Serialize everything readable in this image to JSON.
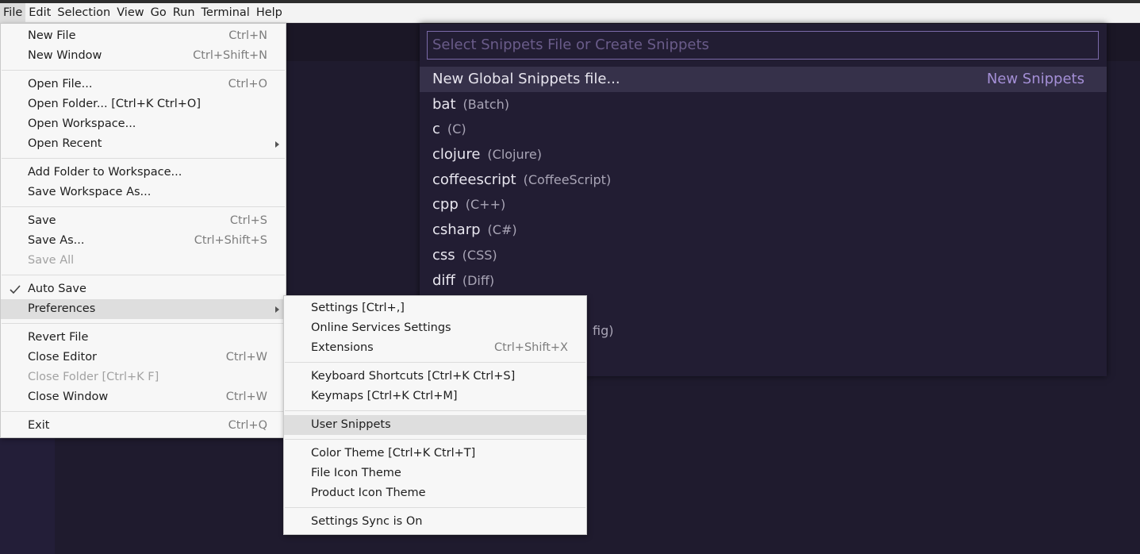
{
  "menubar": {
    "items": [
      "File",
      "Edit",
      "Selection",
      "View",
      "Go",
      "Run",
      "Terminal",
      "Help"
    ]
  },
  "quickpick": {
    "placeholder": "Select Snippets File or Create Snippets",
    "new_global": {
      "label": "New Global Snippets file...",
      "right": "New Snippets"
    },
    "items": [
      {
        "name": "bat",
        "desc": "(Batch)"
      },
      {
        "name": "c",
        "desc": "(C)"
      },
      {
        "name": "clojure",
        "desc": "(Clojure)"
      },
      {
        "name": "coffeescript",
        "desc": "(CoffeeScript)"
      },
      {
        "name": "cpp",
        "desc": "(C++)"
      },
      {
        "name": "csharp",
        "desc": "(C#)"
      },
      {
        "name": "css",
        "desc": "(CSS)"
      },
      {
        "name": "diff",
        "desc": "(Diff)"
      }
    ],
    "partial_visible": "fig)"
  },
  "file_menu": {
    "new_file": {
      "label": "New File",
      "shortcut": "Ctrl+N"
    },
    "new_window": {
      "label": "New Window",
      "shortcut": "Ctrl+Shift+N"
    },
    "open_file": {
      "label": "Open File...",
      "shortcut": "Ctrl+O"
    },
    "open_folder": {
      "label": "Open Folder... [Ctrl+K Ctrl+O]"
    },
    "open_workspace": {
      "label": "Open Workspace..."
    },
    "open_recent": {
      "label": "Open Recent"
    },
    "add_folder": {
      "label": "Add Folder to Workspace..."
    },
    "save_workspace_as": {
      "label": "Save Workspace As..."
    },
    "save": {
      "label": "Save",
      "shortcut": "Ctrl+S"
    },
    "save_as": {
      "label": "Save As...",
      "shortcut": "Ctrl+Shift+S"
    },
    "save_all": {
      "label": "Save All"
    },
    "auto_save": {
      "label": "Auto Save"
    },
    "preferences": {
      "label": "Preferences"
    },
    "revert_file": {
      "label": "Revert File"
    },
    "close_editor": {
      "label": "Close Editor",
      "shortcut": "Ctrl+W"
    },
    "close_folder": {
      "label": "Close Folder [Ctrl+K F]"
    },
    "close_window": {
      "label": "Close Window",
      "shortcut": "Ctrl+W"
    },
    "exit": {
      "label": "Exit",
      "shortcut": "Ctrl+Q"
    }
  },
  "prefs_menu": {
    "settings": {
      "label": "Settings [Ctrl+,]"
    },
    "online_services": {
      "label": "Online Services Settings"
    },
    "extensions": {
      "label": "Extensions",
      "shortcut": "Ctrl+Shift+X"
    },
    "keyboard_shortcuts": {
      "label": "Keyboard Shortcuts [Ctrl+K Ctrl+S]"
    },
    "keymaps": {
      "label": "Keymaps [Ctrl+K Ctrl+M]"
    },
    "user_snippets": {
      "label": "User Snippets"
    },
    "color_theme": {
      "label": "Color Theme [Ctrl+K Ctrl+T]"
    },
    "file_icon_theme": {
      "label": "File Icon Theme"
    },
    "product_icon_theme": {
      "label": "Product Icon Theme"
    },
    "settings_sync": {
      "label": "Settings Sync is On"
    }
  }
}
